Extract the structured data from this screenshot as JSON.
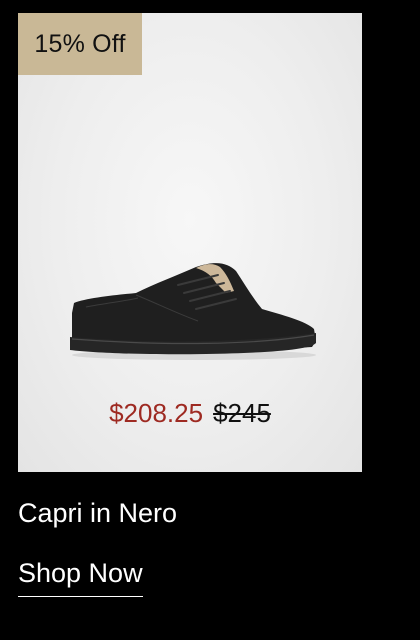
{
  "product_card": {
    "badge": "15% Off",
    "image_alt": "black leather low-top sneaker",
    "price": {
      "sale": "$208.25",
      "original": "$245"
    }
  },
  "product_name": "Capri in Nero",
  "cta_label": "Shop Now",
  "colors": {
    "page_background": "#000000",
    "card_background": "#eeeeee",
    "badge_background": "#c9b896",
    "sale_price": "#9e2a22",
    "text_light": "#ffffff"
  }
}
